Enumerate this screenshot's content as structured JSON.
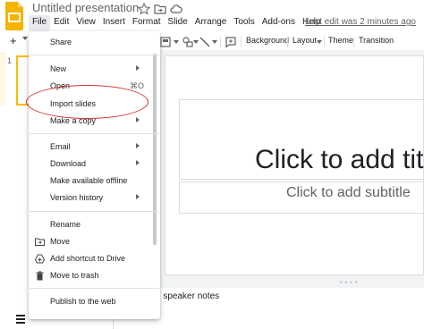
{
  "app": {
    "title": "Untitled presentation",
    "last_edit": "Last edit was 2 minutes ago",
    "brand_color": "#f4b400"
  },
  "menubar": {
    "items": [
      "File",
      "Edit",
      "View",
      "Insert",
      "Format",
      "Slide",
      "Arrange",
      "Tools",
      "Add-ons",
      "Help"
    ],
    "active": "File"
  },
  "toolbar": {
    "add_label": "+",
    "background_label": "Background",
    "layout_label": "Layout",
    "theme_label": "Theme",
    "transition_label": "Transition"
  },
  "filmstrip": {
    "slide_number": "1"
  },
  "slide": {
    "title_placeholder": "Click to add titl",
    "subtitle_placeholder": "Click to add subtitle"
  },
  "speaker_notes": "d speaker notes",
  "file_menu": {
    "share": "Share",
    "new": "New",
    "open": "Open",
    "open_shortcut": "⌘O",
    "import_slides": "Import slides",
    "make_copy": "Make a copy",
    "email": "Email",
    "download": "Download",
    "make_offline": "Make available offline",
    "version_history": "Version history",
    "rename": "Rename",
    "move": "Move",
    "add_shortcut": "Add shortcut to Drive",
    "move_to_trash": "Move to trash",
    "publish": "Publish to the web"
  },
  "annotation": {
    "highlight_color": "#d32f2f"
  }
}
